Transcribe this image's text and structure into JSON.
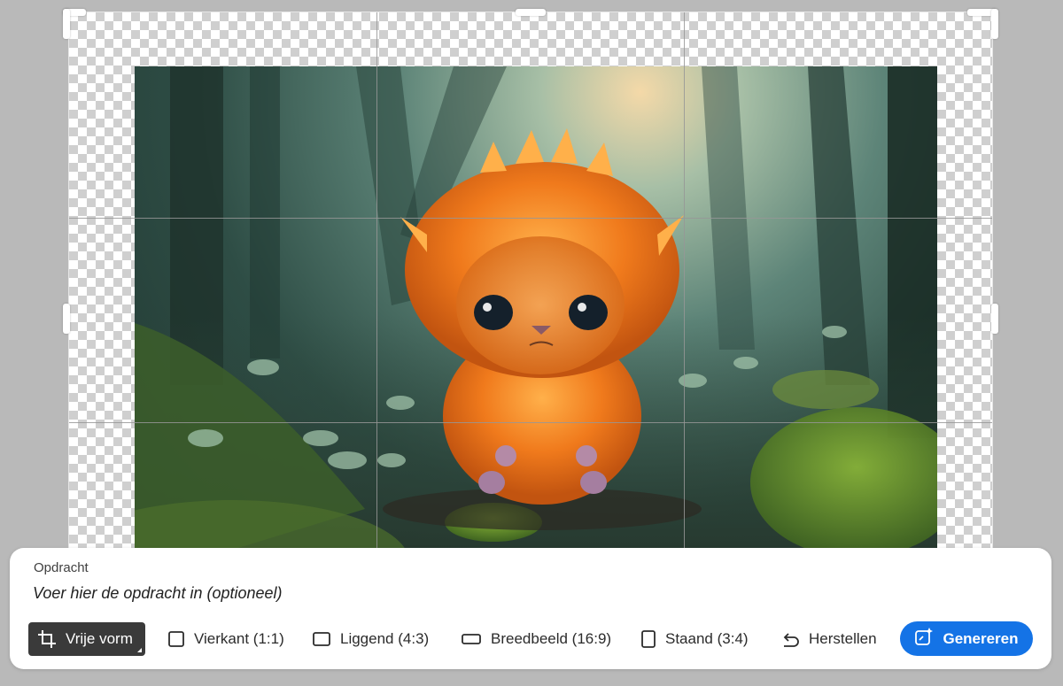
{
  "prompt": {
    "label": "Opdracht",
    "placeholder": "Voer hier de opdracht in (optioneel)",
    "value": ""
  },
  "aspect_options": [
    {
      "label": "Vrije vorm",
      "icon": "crop-icon",
      "selected": true
    },
    {
      "label": "Vierkant (1:1)",
      "icon": "square-icon",
      "selected": false
    },
    {
      "label": "Liggend (4:3)",
      "icon": "landscape-icon",
      "selected": false
    },
    {
      "label": "Breedbeeld (16:9)",
      "icon": "widescreen-icon",
      "selected": false
    },
    {
      "label": "Staand (3:4)",
      "icon": "portrait-icon",
      "selected": false
    }
  ],
  "reset": {
    "label": "Herstellen",
    "icon": "undo-icon"
  },
  "generate": {
    "label": "Genereren",
    "icon": "generative-expand-icon"
  },
  "colors": {
    "accent": "#1473e6",
    "selected_option_bg": "#3a3a3a",
    "workspace_bg": "#b9b9b9"
  }
}
